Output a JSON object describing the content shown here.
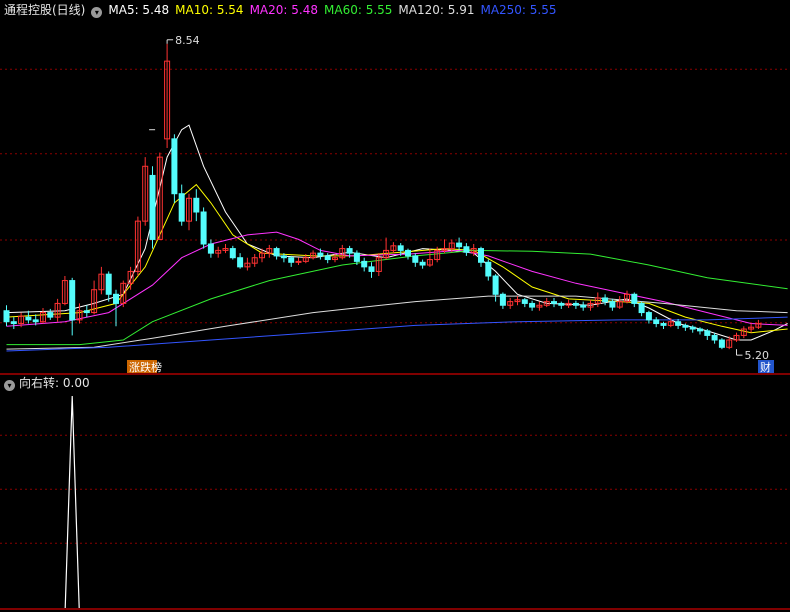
{
  "header": {
    "title": "通程控股(日线)",
    "ma": [
      {
        "label": "MA5:",
        "value": "5.48",
        "color": "#ffffff"
      },
      {
        "label": "MA10:",
        "value": "5.54",
        "color": "#ffff00"
      },
      {
        "label": "MA20:",
        "value": "5.48",
        "color": "#ff33ff"
      },
      {
        "label": "MA60:",
        "value": "5.55",
        "color": "#33ee33"
      },
      {
        "label": "MA120:",
        "value": "5.91",
        "color": "#dddddd"
      },
      {
        "label": "MA250:",
        "value": "5.55",
        "color": "#3355ff"
      }
    ]
  },
  "indicator": {
    "label": "向右转",
    "value": ": 0.00"
  },
  "markers": {
    "high_label": "8.54",
    "low_label": "5.20",
    "event_left": "涨跌榜",
    "event_right": "财"
  },
  "colors": {
    "up": "#ff3232",
    "down": "#54fcfc",
    "grid": "#8b0000",
    "frame": "#aa0000"
  },
  "chart_data": {
    "type": "candlestick",
    "ylim": [
      4.95,
      8.8
    ],
    "sub_ylim": [
      0,
      1
    ],
    "grid": true,
    "candles": [
      [
        5.62,
        5.5,
        5.68,
        5.45
      ],
      [
        5.5,
        5.48,
        5.55,
        5.42
      ],
      [
        5.48,
        5.56,
        5.6,
        5.44
      ],
      [
        5.55,
        5.52,
        5.62,
        5.48
      ],
      [
        5.52,
        5.5,
        5.58,
        5.46
      ],
      [
        5.5,
        5.6,
        5.65,
        5.48
      ],
      [
        5.6,
        5.55,
        5.64,
        5.52
      ],
      [
        5.55,
        5.7,
        5.75,
        5.5
      ],
      [
        5.7,
        5.95,
        6.0,
        5.68
      ],
      [
        5.95,
        5.52,
        5.98,
        5.35
      ],
      [
        5.52,
        5.62,
        5.7,
        5.48
      ],
      [
        5.62,
        5.6,
        5.68,
        5.55
      ],
      [
        5.6,
        5.85,
        5.95,
        5.58
      ],
      [
        5.85,
        6.02,
        6.1,
        5.8
      ],
      [
        6.02,
        5.8,
        6.05,
        5.72
      ],
      [
        5.8,
        5.7,
        5.85,
        5.45
      ],
      [
        5.7,
        5.92,
        5.95,
        5.66
      ],
      [
        5.92,
        6.05,
        6.1,
        5.85
      ],
      [
        6.05,
        6.6,
        6.65,
        6.0
      ],
      [
        6.6,
        7.2,
        7.3,
        6.55
      ],
      [
        7.1,
        6.4,
        7.2,
        6.3
      ],
      [
        6.4,
        7.3,
        7.35,
        6.4
      ],
      [
        7.5,
        8.35,
        8.54,
        7.4
      ],
      [
        7.5,
        6.9,
        7.55,
        6.8
      ],
      [
        6.9,
        6.6,
        7.0,
        6.55
      ],
      [
        6.6,
        6.85,
        6.9,
        6.5
      ],
      [
        6.85,
        6.7,
        6.95,
        6.6
      ],
      [
        6.7,
        6.35,
        6.75,
        6.3
      ],
      [
        6.35,
        6.25,
        6.4,
        6.2
      ],
      [
        6.25,
        6.28,
        6.32,
        6.2
      ],
      [
        6.28,
        6.3,
        6.35,
        6.25
      ],
      [
        6.3,
        6.2,
        6.33,
        6.18
      ],
      [
        6.2,
        6.1,
        6.25,
        6.08
      ],
      [
        6.1,
        6.14,
        6.2,
        6.06
      ],
      [
        6.14,
        6.2,
        6.24,
        6.1
      ],
      [
        6.2,
        6.25,
        6.3,
        6.15
      ],
      [
        6.25,
        6.3,
        6.34,
        6.2
      ],
      [
        6.3,
        6.22,
        6.32,
        6.18
      ],
      [
        6.22,
        6.2,
        6.25,
        6.15
      ],
      [
        6.2,
        6.15,
        6.22,
        6.1
      ],
      [
        6.15,
        6.16,
        6.2,
        6.12
      ],
      [
        6.16,
        6.2,
        6.24,
        6.14
      ],
      [
        6.2,
        6.25,
        6.28,
        6.18
      ],
      [
        6.25,
        6.22,
        6.3,
        6.18
      ],
      [
        6.22,
        6.18,
        6.25,
        6.14
      ],
      [
        6.18,
        6.2,
        6.24,
        6.15
      ],
      [
        6.2,
        6.3,
        6.34,
        6.18
      ],
      [
        6.3,
        6.25,
        6.33,
        6.2
      ],
      [
        6.25,
        6.16,
        6.28,
        6.12
      ],
      [
        6.16,
        6.1,
        6.2,
        6.05
      ],
      [
        6.1,
        6.05,
        6.15,
        5.98
      ],
      [
        6.05,
        6.2,
        6.25,
        6.0
      ],
      [
        6.2,
        6.28,
        6.42,
        6.18
      ],
      [
        6.28,
        6.33,
        6.37,
        6.25
      ],
      [
        6.33,
        6.28,
        6.36,
        6.22
      ],
      [
        6.28,
        6.22,
        6.3,
        6.18
      ],
      [
        6.22,
        6.15,
        6.25,
        6.1
      ],
      [
        6.15,
        6.12,
        6.18,
        6.08
      ],
      [
        6.12,
        6.18,
        6.3,
        6.1
      ],
      [
        6.18,
        6.28,
        6.32,
        6.15
      ],
      [
        6.28,
        6.3,
        6.4,
        6.25
      ],
      [
        6.3,
        6.36,
        6.4,
        6.26
      ],
      [
        6.36,
        6.32,
        6.42,
        6.28
      ],
      [
        6.32,
        6.26,
        6.36,
        6.22
      ],
      [
        6.26,
        6.3,
        6.35,
        6.22
      ],
      [
        6.3,
        6.15,
        6.32,
        6.1
      ],
      [
        6.15,
        6.0,
        6.18,
        5.95
      ],
      [
        6.0,
        5.8,
        6.02,
        5.72
      ],
      [
        5.8,
        5.68,
        5.82,
        5.64
      ],
      [
        5.68,
        5.72,
        5.76,
        5.64
      ],
      [
        5.72,
        5.74,
        5.78,
        5.68
      ],
      [
        5.74,
        5.7,
        5.76,
        5.66
      ],
      [
        5.7,
        5.66,
        5.73,
        5.62
      ],
      [
        5.66,
        5.68,
        5.72,
        5.62
      ],
      [
        5.68,
        5.72,
        5.76,
        5.66
      ],
      [
        5.72,
        5.7,
        5.76,
        5.66
      ],
      [
        5.7,
        5.68,
        5.72,
        5.64
      ],
      [
        5.68,
        5.7,
        5.74,
        5.65
      ],
      [
        5.7,
        5.68,
        5.73,
        5.64
      ],
      [
        5.68,
        5.66,
        5.72,
        5.62
      ],
      [
        5.66,
        5.7,
        5.74,
        5.62
      ],
      [
        5.7,
        5.76,
        5.82,
        5.66
      ],
      [
        5.76,
        5.72,
        5.8,
        5.68
      ],
      [
        5.72,
        5.66,
        5.75,
        5.62
      ],
      [
        5.66,
        5.72,
        5.78,
        5.64
      ],
      [
        5.72,
        5.8,
        5.84,
        5.7
      ],
      [
        5.8,
        5.7,
        5.82,
        5.66
      ],
      [
        5.7,
        5.6,
        5.72,
        5.56
      ],
      [
        5.6,
        5.52,
        5.62,
        5.48
      ],
      [
        5.52,
        5.48,
        5.55,
        5.44
      ],
      [
        5.48,
        5.46,
        5.5,
        5.42
      ],
      [
        5.46,
        5.5,
        5.54,
        5.44
      ],
      [
        5.5,
        5.46,
        5.53,
        5.42
      ],
      [
        5.46,
        5.44,
        5.48,
        5.4
      ],
      [
        5.44,
        5.42,
        5.46,
        5.38
      ],
      [
        5.42,
        5.4,
        5.44,
        5.36
      ],
      [
        5.4,
        5.35,
        5.42,
        5.3
      ],
      [
        5.35,
        5.3,
        5.38,
        5.26
      ],
      [
        5.3,
        5.22,
        5.32,
        5.2
      ],
      [
        5.22,
        5.3,
        5.34,
        5.2
      ],
      [
        5.3,
        5.35,
        5.38,
        5.28
      ],
      [
        5.35,
        5.42,
        5.45,
        5.32
      ],
      [
        5.42,
        5.44,
        5.48,
        5.38
      ],
      [
        5.44,
        5.48,
        5.52,
        5.42
      ]
    ],
    "ma_lines": [
      {
        "name": "MA5",
        "color": "#ffffff",
        "values": [
          [
            0,
            5.6
          ],
          [
            8,
            5.62
          ],
          [
            12,
            5.7
          ],
          [
            16,
            5.8
          ],
          [
            19,
            6.3
          ],
          [
            22,
            7.3
          ],
          [
            24,
            7.6
          ],
          [
            25,
            7.65
          ],
          [
            27,
            7.2
          ],
          [
            30,
            6.7
          ],
          [
            33,
            6.35
          ],
          [
            37,
            6.22
          ],
          [
            42,
            6.2
          ],
          [
            47,
            6.26
          ],
          [
            52,
            6.2
          ],
          [
            57,
            6.3
          ],
          [
            61,
            6.28
          ],
          [
            64,
            6.25
          ],
          [
            67,
            6.05
          ],
          [
            70,
            5.8
          ],
          [
            74,
            5.7
          ],
          [
            80,
            5.68
          ],
          [
            85,
            5.75
          ],
          [
            88,
            5.65
          ],
          [
            92,
            5.48
          ],
          [
            96,
            5.4
          ],
          [
            100,
            5.3
          ],
          [
            102,
            5.3
          ],
          [
            105,
            5.4
          ],
          [
            107,
            5.48
          ]
        ]
      },
      {
        "name": "MA10",
        "color": "#ffff00",
        "values": [
          [
            0,
            5.55
          ],
          [
            10,
            5.6
          ],
          [
            15,
            5.7
          ],
          [
            19,
            6.1
          ],
          [
            23,
            6.8
          ],
          [
            26,
            7.0
          ],
          [
            28,
            6.8
          ],
          [
            31,
            6.45
          ],
          [
            35,
            6.25
          ],
          [
            42,
            6.22
          ],
          [
            48,
            6.22
          ],
          [
            54,
            6.26
          ],
          [
            60,
            6.3
          ],
          [
            64,
            6.28
          ],
          [
            68,
            6.1
          ],
          [
            72,
            5.88
          ],
          [
            77,
            5.75
          ],
          [
            84,
            5.72
          ],
          [
            88,
            5.7
          ],
          [
            93,
            5.55
          ],
          [
            98,
            5.45
          ],
          [
            102,
            5.38
          ],
          [
            107,
            5.42
          ]
        ]
      },
      {
        "name": "MA20",
        "color": "#ff33ff",
        "values": [
          [
            0,
            5.45
          ],
          [
            8,
            5.5
          ],
          [
            14,
            5.6
          ],
          [
            20,
            5.9
          ],
          [
            24,
            6.2
          ],
          [
            28,
            6.35
          ],
          [
            33,
            6.45
          ],
          [
            37,
            6.48
          ],
          [
            40,
            6.4
          ],
          [
            43,
            6.28
          ],
          [
            47,
            6.22
          ],
          [
            55,
            6.24
          ],
          [
            62,
            6.28
          ],
          [
            66,
            6.22
          ],
          [
            72,
            6.05
          ],
          [
            78,
            5.92
          ],
          [
            84,
            5.82
          ],
          [
            90,
            5.72
          ],
          [
            96,
            5.6
          ],
          [
            102,
            5.48
          ],
          [
            107,
            5.46
          ]
        ]
      },
      {
        "name": "MA60",
        "color": "#33ee33",
        "values": [
          [
            0,
            5.25
          ],
          [
            10,
            5.25
          ],
          [
            16,
            5.3
          ],
          [
            20,
            5.5
          ],
          [
            28,
            5.75
          ],
          [
            36,
            5.95
          ],
          [
            46,
            6.12
          ],
          [
            56,
            6.22
          ],
          [
            64,
            6.28
          ],
          [
            72,
            6.27
          ],
          [
            80,
            6.24
          ],
          [
            88,
            6.12
          ],
          [
            96,
            5.98
          ],
          [
            107,
            5.86
          ]
        ]
      },
      {
        "name": "MA120",
        "color": "#dddddd",
        "values": [
          [
            0,
            5.2
          ],
          [
            12,
            5.22
          ],
          [
            20,
            5.32
          ],
          [
            30,
            5.45
          ],
          [
            42,
            5.6
          ],
          [
            56,
            5.72
          ],
          [
            66,
            5.78
          ],
          [
            78,
            5.78
          ],
          [
            90,
            5.7
          ],
          [
            100,
            5.62
          ],
          [
            107,
            5.6
          ]
        ]
      },
      {
        "name": "MA250",
        "color": "#3355ff",
        "values": [
          [
            0,
            5.18
          ],
          [
            14,
            5.22
          ],
          [
            28,
            5.3
          ],
          [
            42,
            5.38
          ],
          [
            56,
            5.46
          ],
          [
            70,
            5.5
          ],
          [
            84,
            5.52
          ],
          [
            96,
            5.52
          ],
          [
            107,
            5.55
          ]
        ]
      }
    ],
    "signal_peaks": [
      {
        "index": 9,
        "value": 1
      }
    ]
  }
}
